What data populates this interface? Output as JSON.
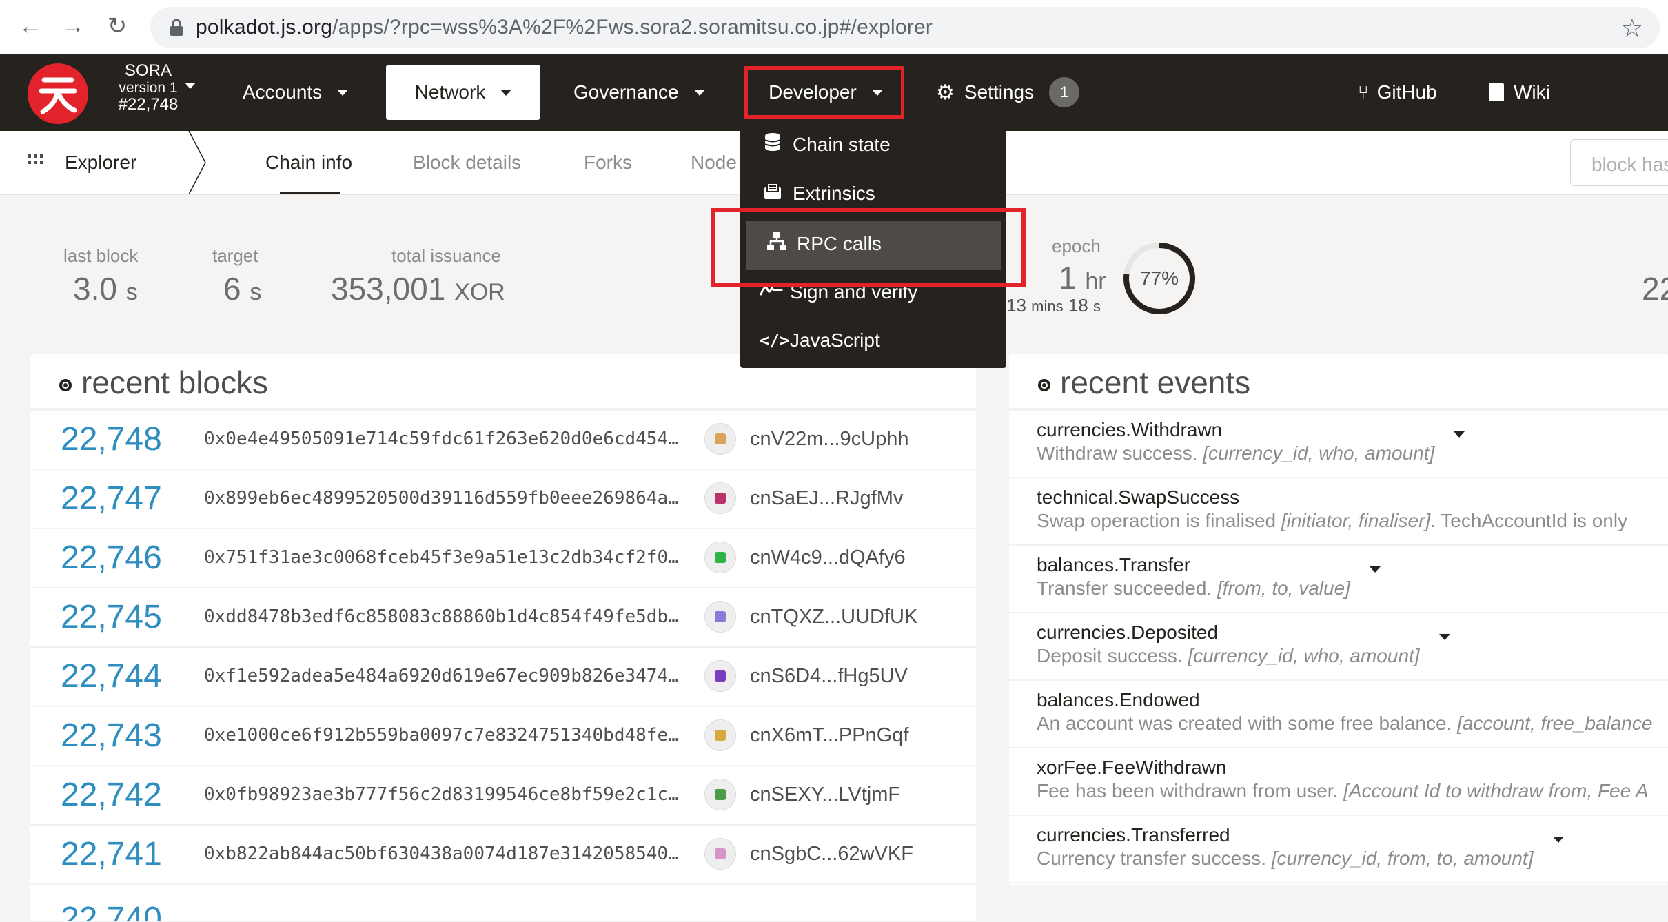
{
  "browser": {
    "url_host": "polkadot.js.org",
    "url_rest": "/apps/?rpc=wss%3A%2F%2Fws.sora2.soramitsu.co.jp#/explorer"
  },
  "header": {
    "chain_name": "SORA",
    "chain_version": "version 1",
    "block_number": "#22,748",
    "menus": {
      "accounts": "Accounts",
      "network": "Network",
      "governance": "Governance",
      "developer": "Developer",
      "settings": "Settings",
      "settings_badge": "1",
      "github": "GitHub",
      "wiki": "Wiki"
    }
  },
  "subnav": {
    "section": "Explorer",
    "tabs": [
      "Chain info",
      "Block details",
      "Forks",
      "Node"
    ],
    "search_placeholder": "block hash"
  },
  "summary": {
    "last_block_label": "last block",
    "last_block_value": "3.0",
    "last_block_unit": "s",
    "target_label": "target",
    "target_value": "6",
    "target_unit": "s",
    "issuance_label": "total issuance",
    "issuance_value": "353,001",
    "issuance_unit": "XOR",
    "epoch_label": "epoch",
    "epoch_value": "1",
    "epoch_unit": "hr",
    "epoch_sub_mins": "13",
    "epoch_sub_mins_unit": "mins",
    "epoch_sub_secs": "18",
    "epoch_sub_secs_unit": "s",
    "epoch_percent": "77%",
    "epoch_fraction": 0.77,
    "right_cut": "22"
  },
  "developer_menu": {
    "items": [
      "Chain state",
      "Extrinsics",
      "RPC calls",
      "Sign and verify",
      "JavaScript"
    ],
    "selected": "RPC calls"
  },
  "recent_blocks": {
    "title": "recent blocks",
    "rows": [
      {
        "number": "22,748",
        "hash": "0x0e4e49505091e714c59fdc61f263e620d0e6cd454…",
        "author": "cnV22m...9cUphh",
        "color": "#d9a35a"
      },
      {
        "number": "22,747",
        "hash": "0x899eb6ec4899520500d39116d559fb0eee269864a…",
        "author": "cnSaEJ...RJgfMv",
        "color": "#b8336a"
      },
      {
        "number": "22,746",
        "hash": "0x751f31ae3c0068fceb45f3e9a51e13c2db34cf2f0…",
        "author": "cnW4c9...dQAfy6",
        "color": "#2fb44a"
      },
      {
        "number": "22,745",
        "hash": "0xdd8478b3edf6c858083c88860b1d4c854f49fe5db…",
        "author": "cnTQXZ...UUDfUK",
        "color": "#8e7ad6"
      },
      {
        "number": "22,744",
        "hash": "0xf1e592adea5e484a6920d619e67ec909b826e3474…",
        "author": "cnS6D4...fHg5UV",
        "color": "#7a3fc0"
      },
      {
        "number": "22,743",
        "hash": "0xe1000ce6f912b559ba0097c7e8324751340bd48fe…",
        "author": "cnX6mT...PPnGqf",
        "color": "#d6a93c"
      },
      {
        "number": "22,742",
        "hash": "0x0fb98923ae3b777f56c2d83199546ce8bf59e2c1c…",
        "author": "cnSEXY...LVtjmF",
        "color": "#4c9a4a"
      },
      {
        "number": "22,741",
        "hash": "0xb822ab844ac50bf630438a0074d187e3142058540…",
        "author": "cnSgbC...62wVKF",
        "color": "#d495c8"
      }
    ]
  },
  "recent_events": {
    "title": "recent events",
    "rows": [
      {
        "name": "currencies.Withdrawn",
        "desc": "Withdraw success. ",
        "params": "[currency_id, who, amount]",
        "tail": "",
        "caret": true
      },
      {
        "name": "technical.SwapSuccess",
        "desc": "Swap operaction is finalised ",
        "params": "[initiator, finaliser]",
        "tail": ". TechAccountId is only",
        "caret": false
      },
      {
        "name": "balances.Transfer",
        "desc": "Transfer succeeded. ",
        "params": "[from, to, value]",
        "tail": "",
        "caret": true
      },
      {
        "name": "currencies.Deposited",
        "desc": "Deposit success. ",
        "params": "[currency_id, who, amount]",
        "tail": "",
        "caret": true
      },
      {
        "name": "balances.Endowed",
        "desc": "An account was created with some free balance. ",
        "params": "[account, free_balance",
        "tail": "",
        "caret": false
      },
      {
        "name": "xorFee.FeeWithdrawn",
        "desc": "Fee has been withdrawn from user. ",
        "params": "[Account Id to withdraw from, Fee A",
        "tail": "",
        "caret": false
      },
      {
        "name": "currencies.Transferred",
        "desc": "Currency transfer success. ",
        "params": "[currency_id, from, to, amount]",
        "tail": "",
        "caret": true
      }
    ]
  },
  "colors": {
    "header_bg": "#26231f",
    "accent_red": "#e3232c",
    "block_number_blue": "#2f8ec0",
    "page_bg": "#f5f4f3"
  }
}
